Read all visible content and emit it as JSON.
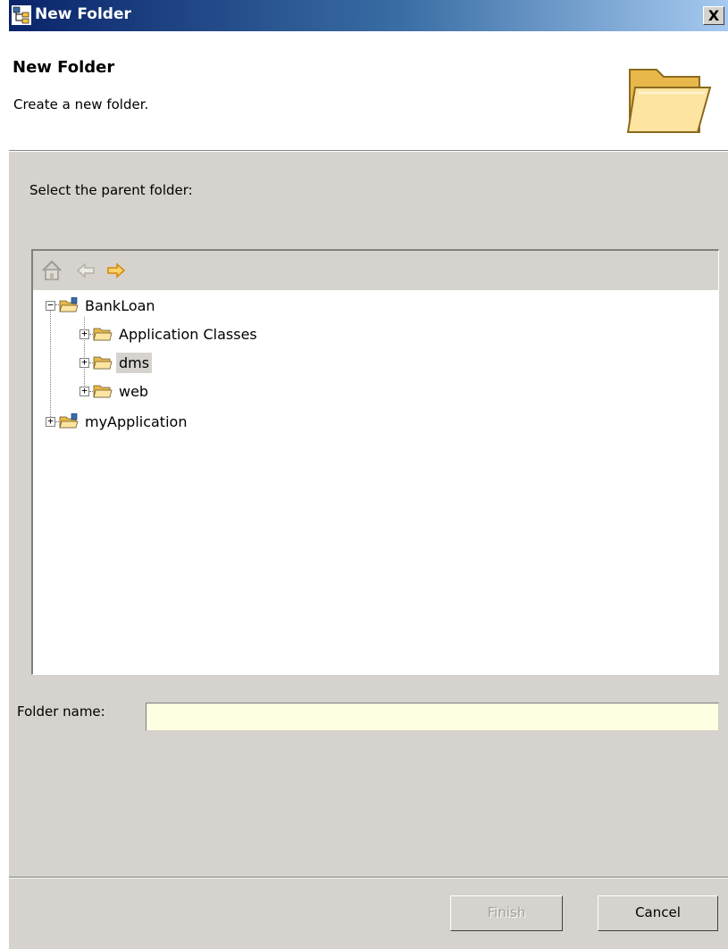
{
  "window": {
    "title": "New Folder",
    "close_label": "X",
    "icon": "dialog-app-icon"
  },
  "banner": {
    "title": "New Folder",
    "description": "Create a new folder.",
    "icon": "open-folder-icon"
  },
  "main": {
    "select_label": "Select the parent folder:",
    "toolbar": {
      "home_icon": "home-icon",
      "back_icon": "back-arrow-icon",
      "forward_icon": "forward-arrow-icon"
    },
    "tree": [
      {
        "label": "BankLoan",
        "icon": "project-folder-icon",
        "expanded": true
      },
      {
        "label": "Application Classes",
        "icon": "folder-icon",
        "expanded": false
      },
      {
        "label": "dms",
        "icon": "folder-icon",
        "expanded": false,
        "selected": true
      },
      {
        "label": "web",
        "icon": "folder-icon",
        "expanded": false
      },
      {
        "label": "myApplication",
        "icon": "project-folder-icon",
        "expanded": false
      }
    ]
  },
  "folder_name": {
    "label": "Folder name:",
    "value": "",
    "placeholder": ""
  },
  "buttons": {
    "finish": "Finish",
    "cancel": "Cancel"
  },
  "colors": {
    "dialog_bg": "#d6d3ce",
    "titlebar_start": "#0a246a",
    "titlebar_end": "#a6caf0",
    "input_bg": "#ffffe1",
    "folder_yellow": "#f5c542"
  }
}
